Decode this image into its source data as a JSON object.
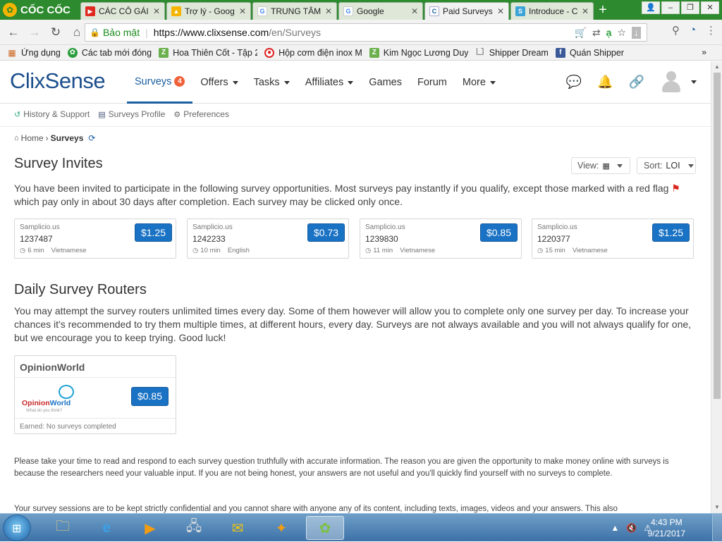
{
  "browser": {
    "brand_name": "CỐC CỐC",
    "tabs": [
      {
        "title": "CÁC CÔ GÁI",
        "icon": "youtube-icon"
      },
      {
        "title": "Trợ lý - Goog",
        "icon": "google-drive-icon"
      },
      {
        "title": "TRUNG TÂM",
        "icon": "google-icon"
      },
      {
        "title": "Google",
        "icon": "google-icon"
      },
      {
        "title": "Paid Surveys",
        "icon": "clixsense-icon"
      },
      {
        "title": "Introduce - C",
        "icon": "swagbucks-icon"
      }
    ],
    "active_tab": 4,
    "address": {
      "secure_label": "Bảo mật",
      "url_host": "https://www.clixsense.com",
      "url_path": "/en/Surveys"
    },
    "bookmarks": [
      {
        "label": "Ứng dụng",
        "icon": "apps-grid-icon"
      },
      {
        "label": "Các tab mới đóng",
        "icon": "leaf-icon"
      },
      {
        "label": "Hoa Thiên Cốt - Tập 2",
        "icon": "z-icon"
      },
      {
        "label": "Hộp cơm điện inox M",
        "icon": "target-icon"
      },
      {
        "label": "Kim Ngọc Lương Duy",
        "icon": "z-icon"
      },
      {
        "label": "Shipper Dream",
        "icon": "page-icon"
      },
      {
        "label": "Quán Shipper",
        "icon": "facebook-icon"
      }
    ]
  },
  "site": {
    "logo": "ClixSense",
    "nav": [
      {
        "label": "Surveys",
        "badge": "4"
      },
      {
        "label": "Offers"
      },
      {
        "label": "Tasks"
      },
      {
        "label": "Affiliates"
      },
      {
        "label": "Games"
      },
      {
        "label": "Forum"
      },
      {
        "label": "More"
      }
    ],
    "subnav": [
      "History & Support",
      "Surveys Profile",
      "Preferences"
    ],
    "breadcrumb": {
      "home": "Home",
      "current": "Surveys"
    }
  },
  "invites": {
    "title": "Survey Invites",
    "view_label": "View:",
    "sort_label": "Sort:",
    "sort_value": "LOI",
    "intro_part1": "You have been invited to participate in the following survey opportunities. Most surveys pay instantly if you qualify, except those marked with a red flag",
    "intro_part2": "which pay only in about 30 days after completion. Each survey may be clicked only once.",
    "cards": [
      {
        "provider": "Samplicio.us",
        "id": "1237487",
        "duration": "6 min",
        "language": "Vietnamese",
        "price": "$1.25"
      },
      {
        "provider": "Samplicio.us",
        "id": "1242233",
        "duration": "10 min",
        "language": "English",
        "price": "$0.73"
      },
      {
        "provider": "Samplicio.us",
        "id": "1239830",
        "duration": "11 min",
        "language": "Vietnamese",
        "price": "$0.85"
      },
      {
        "provider": "Samplicio.us",
        "id": "1220377",
        "duration": "15 min",
        "language": "Vietnamese",
        "price": "$1.25"
      }
    ]
  },
  "routers": {
    "title": "Daily Survey Routers",
    "intro": "You may attempt the survey routers unlimited times every day. Some of them however will allow you to complete only one survey per day. To increase your chances it's recommended to try them multiple times, at different hours, every day. Surveys are not always available and you will not always qualify for one, but we encourage you to keep trying. Good luck!",
    "card": {
      "name": "OpinionWorld",
      "logo_text_1": "Opinion",
      "logo_text_2": "World",
      "logo_tagline": "What do you think?",
      "price": "$0.85",
      "earned": "Earned: No surveys completed"
    }
  },
  "footer_notes": {
    "p1": "Please take your time to read and respond to each survey question truthfully with accurate information. The reason you are given the opportunity to make money online with surveys is because the researchers need your valuable input. If you are not being honest, your answers are not useful and you'll quickly find yourself with no surveys to complete.",
    "p2": "Your survey sessions are to be kept strictly confidential and you cannot share with anyone any of its content, including texts, images, videos and your answers. This also"
  },
  "taskbar": {
    "apps": [
      "file-explorer-icon",
      "internet-explorer-icon",
      "media-player-icon",
      "network-icon",
      "outlook-icon",
      "fox-icon",
      "coccoc-icon"
    ],
    "time": "4:43 PM",
    "date": "9/21/2017"
  }
}
